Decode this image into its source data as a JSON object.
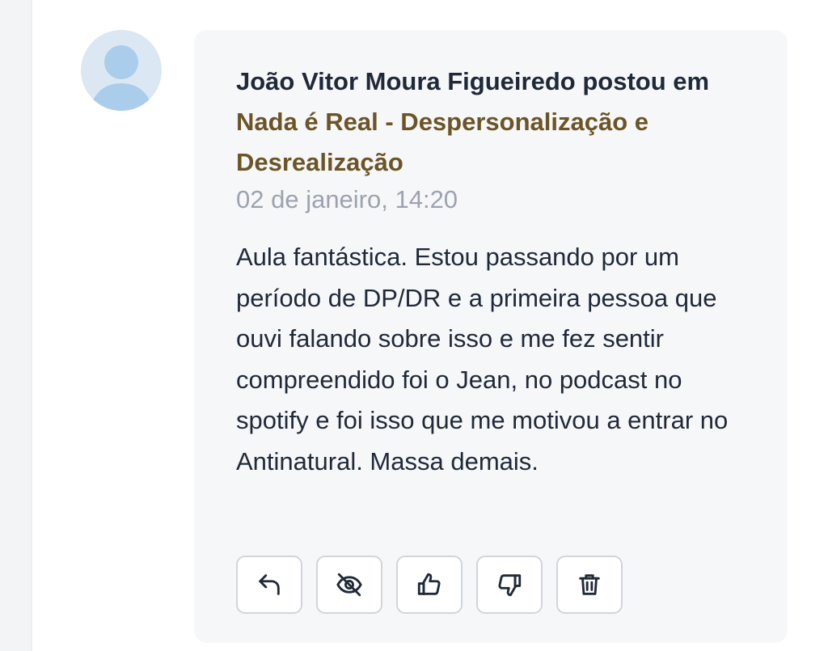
{
  "comment": {
    "author": "João Vitor Moura Figueiredo",
    "action_text": "postou em",
    "group_name": "Nada é Real - Despersonalização e Desrealização",
    "timestamp": "02 de janeiro, 14:20",
    "body": "Aula fantástica. Estou passando por um período de DP/DR e a primeira pessoa que ouvi falando sobre isso e me fez sentir compreendido foi o Jean, no podcast no spotify e foi isso que me motivou a entrar no Antinatural. Massa demais."
  },
  "avatar": {
    "icon": "user-placeholder-icon",
    "background": "#dbe7f3",
    "figure_color": "#a9cdeb"
  },
  "actions": [
    {
      "name": "reply",
      "icon": "reply-icon"
    },
    {
      "name": "hide",
      "icon": "eye-off-icon"
    },
    {
      "name": "like",
      "icon": "thumbs-up-icon"
    },
    {
      "name": "dislike",
      "icon": "thumbs-down-icon"
    },
    {
      "name": "delete",
      "icon": "trash-icon"
    }
  ],
  "colors": {
    "text": "#1f2937",
    "group_link": "#6b5426",
    "timestamp": "#9ca3af",
    "card_background": "#f6f7f9",
    "button_border": "#d1d5db"
  }
}
